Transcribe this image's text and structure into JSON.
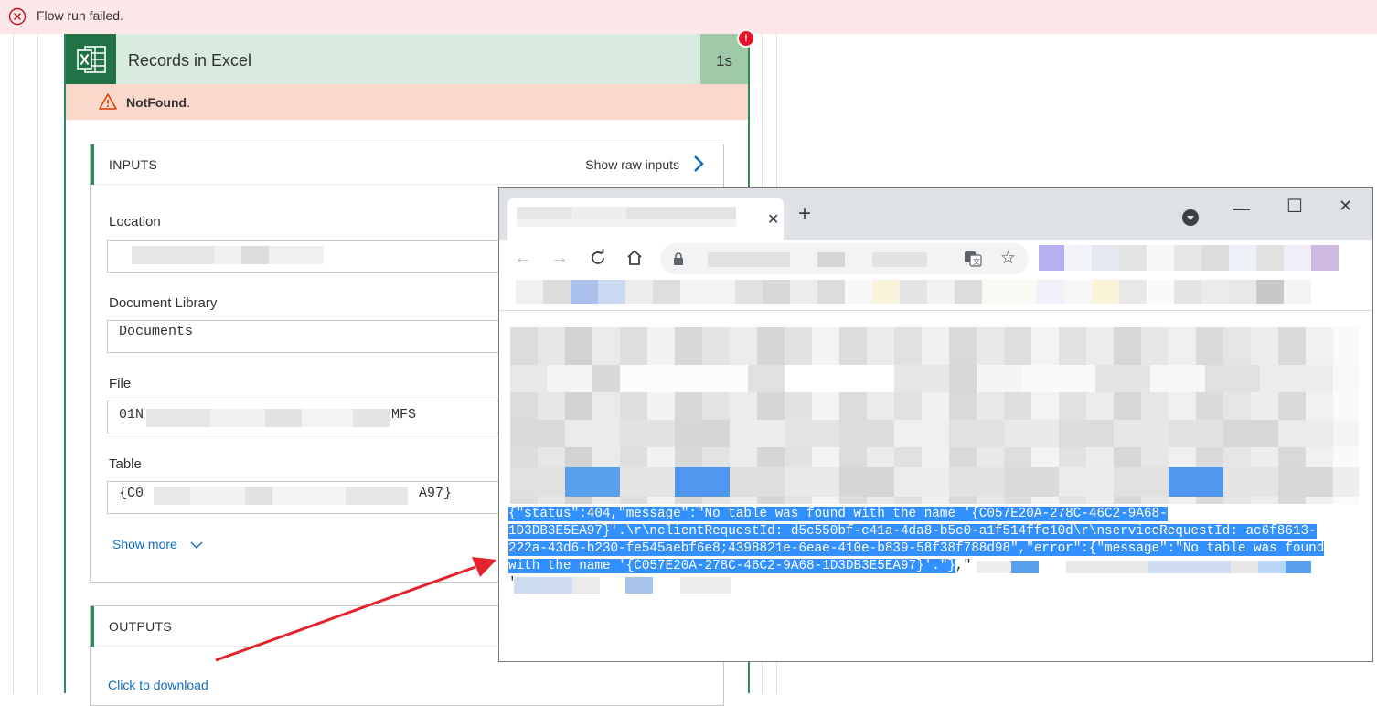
{
  "banner": {
    "message": "Flow run failed."
  },
  "action_card": {
    "title": "Records in Excel",
    "duration": "1s",
    "error_badge": "!",
    "status": "NotFound",
    "status_suffix": "."
  },
  "inputs": {
    "header": "INPUTS",
    "show_raw": "Show raw inputs",
    "fields": [
      {
        "label": "Location",
        "value": ""
      },
      {
        "label": "Document Library",
        "value": "Documents"
      },
      {
        "label": "File",
        "value_start": "01N",
        "value_end": "MFS"
      },
      {
        "label": "Table",
        "value_start": "{C0",
        "value_end": "A97}"
      }
    ],
    "show_more": "Show more"
  },
  "outputs": {
    "header": "OUTPUTS",
    "download": "Click to download"
  },
  "browser": {
    "tab_close": "✕",
    "new_tab": "+",
    "window_controls": {
      "minimize": "—",
      "maximize": "☐",
      "close": "✕"
    },
    "json_lines": [
      "{\"status\":404,\"message\":\"No table was found with the name '{C057E20A-278C-46C2-9A68-",
      "1D3DB3E5EA97}'.\\r\\nclientRequestId: d5c550bf-c41a-4da8-b5c0-a1f514ffe10d\\r\\nserviceRequestId: ac6f8613-",
      "222a-43d6-b230-fe545aebf6e8;4398821e-6eae-410e-b839-58f38f788d98\",\"error\":{\"message\":\"No table was found",
      "with the name '{C057E20A-278C-46C2-9A68-1D3DB3E5EA97}'.\"}"
    ],
    "json_trailing": ",\"",
    "json_next_line": "'"
  },
  "colors": {
    "accent_green": "#2e8b57",
    "error_red": "#e81123",
    "selection_blue": "#3390ff",
    "link_blue": "#0f6cbd"
  },
  "icons": [
    "error-circle-icon",
    "excel-icon",
    "warning-icon",
    "chevron-right-icon",
    "chevron-down-icon",
    "lock-icon",
    "star-icon",
    "translate-icon",
    "reload-icon",
    "home-icon",
    "back-icon",
    "forward-icon"
  ]
}
